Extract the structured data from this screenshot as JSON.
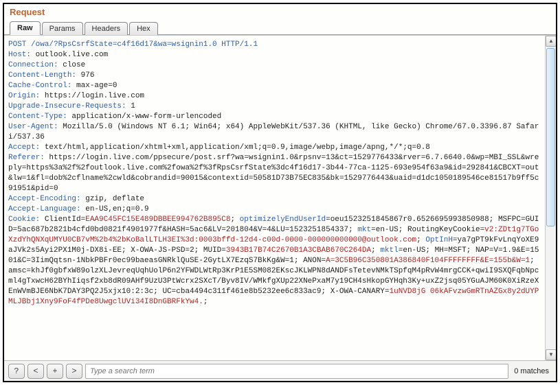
{
  "title": "Request",
  "tabs": [
    "Raw",
    "Params",
    "Headers",
    "Hex"
  ],
  "active_tab": 0,
  "request": {
    "line": "POST /owa/?RpsCsrfState=c4f16d17&wa=wsignin1.0 HTTP/1.1",
    "headers": [
      [
        "Host",
        "outlook.live.com"
      ],
      [
        "Connection",
        "close"
      ],
      [
        "Content-Length",
        "976"
      ],
      [
        "Cache-Control",
        "max-age=0"
      ],
      [
        "Origin",
        "https://login.live.com"
      ],
      [
        "Upgrade-Insecure-Requests",
        "1"
      ],
      [
        "Content-Type",
        "application/x-www-form-urlencoded"
      ],
      [
        "User-Agent",
        "Mozilla/5.0 (Windows NT 6.1; Win64; x64) AppleWebKit/537.36 (KHTML, like Gecko) Chrome/67.0.3396.87 Safari/537.36"
      ],
      [
        "Accept",
        "text/html,application/xhtml+xml,application/xml;q=0.9,image/webp,image/apng,*/*;q=0.8"
      ],
      [
        "Referer",
        "https://login.live.com/ppsecure/post.srf?wa=wsignin1.0&rpsnv=13&ct=1529776433&rver=6.7.6640.0&wp=MBI_SSL&wreply=https%3a%2f%2foutlook.live.com%2fowa%2f%3fRpsCsrfState%3dc4f16d17-3b44-77ca-1125-693e954f63a9&id=292841&CBCXT=out&lw=1&fl=dob%2cflname%2cwld&cobrandid=90015&contextid=50581D73B75EC835&bk=1529776443&uaid=d1dc1050189546ce81517b9ff5c91951&pid=0"
      ],
      [
        "Accept-Encoding",
        "gzip, deflate"
      ],
      [
        "Accept-Language",
        "en-US,en;q=0.9"
      ]
    ],
    "cookie_name": "Cookie",
    "cookies": [
      {
        "k": "ClientId",
        "v": "EAA9C45FC15E489DBBEE994762B895C8",
        "red": true
      },
      {
        "k": "optimizelyEndUserId",
        "v": "oeu1523251845867r0.6526695993850988",
        "red": false,
        "kblue": true
      },
      {
        "k": "MSFPC",
        "v": "GUID=5ac687b2821b4cfd0bd0821f4901977f&HASH=5ac6&LV=201804&V=4&LU=1523251854337",
        "red": false
      },
      {
        "k": "mkt",
        "v": "en-US",
        "red": false,
        "kblue": true
      },
      {
        "k": "RoutingKeyCookie",
        "v": "v2:ZDt1g7TGoXzdYhQNXqUMYU0CB7vM%2b4%2bKoBalLTLH3EI%3d:0003bffd-12d4-c00d-0000-000000000000@outlook.com",
        "red": true
      },
      {
        "k": "OptInH",
        "v": "ya7gPT9kFvLnqYoXE9aJVk2s5Ayi2PX1M0j-DX8i-EE",
        "red": false,
        "kblue": true
      },
      {
        "k": "X-OWA-JS-PSD",
        "v": "2",
        "red": false
      },
      {
        "k": "MUID",
        "v": "3943B17B74C2670B1A3CBAB670C264DA",
        "red": true
      },
      {
        "k": "mktl",
        "v": "en-US",
        "red": false,
        "kblue": true
      },
      {
        "k": "MH",
        "v": "MSFT",
        "red": false
      },
      {
        "k": "NAP",
        "v": "V=1.9&E=1501&C=3IimQqtsn-1NbkPBFr0ec99baeasGNRklQuSE-2GytLX7EzqS7BkKg&W=1",
        "red": false
      },
      {
        "k": "ANON",
        "v": "A=3C5B96C350801A386840F104FFFFFFFF&E=155b&W=1",
        "red": true
      },
      {
        "k": "amsc",
        "v": "khJf0gbfxW89olzXLJevreqUqhUolP6n2YFWDLWtRp3KrP1E5SM082EKscJKLWPN8dANDFsTetevNMkTSpfqM4pRvW4mrgCCK+qwiI9SXQFqbNpcml4gTxwcH62BYhIiqsf2xb8dR09AHf9UzU3PtWcrx2SXcT/Byv8IV/WMkfgXUp22XNePxaM7y19CH4sHkopGYHqh3Ky+uxZ2jsq05YGuAJM60K0XiRzeXEnWVmBJE6NbK7DAY3PQ2J5xjx10:2:3c",
        "red": false
      },
      {
        "k": "UC",
        "v": "cba4494c311f461e8b5232ee6c833ac9",
        "red": false
      },
      {
        "k": "X-OWA-CANARY",
        "v": "1uNVD8jG 06kAFvzwGmRTnAZGx8y2dUYPMLJBbj1Xny9FoF4fPDe8UwgclUVi34I8DnGBRFkYw4.",
        "red": true
      }
    ]
  },
  "footer": {
    "btn_help": "?",
    "btn_prev": "<",
    "btn_add": "+",
    "btn_next": ">",
    "search_placeholder": "Type a search term",
    "matches_label": "0 matches"
  }
}
